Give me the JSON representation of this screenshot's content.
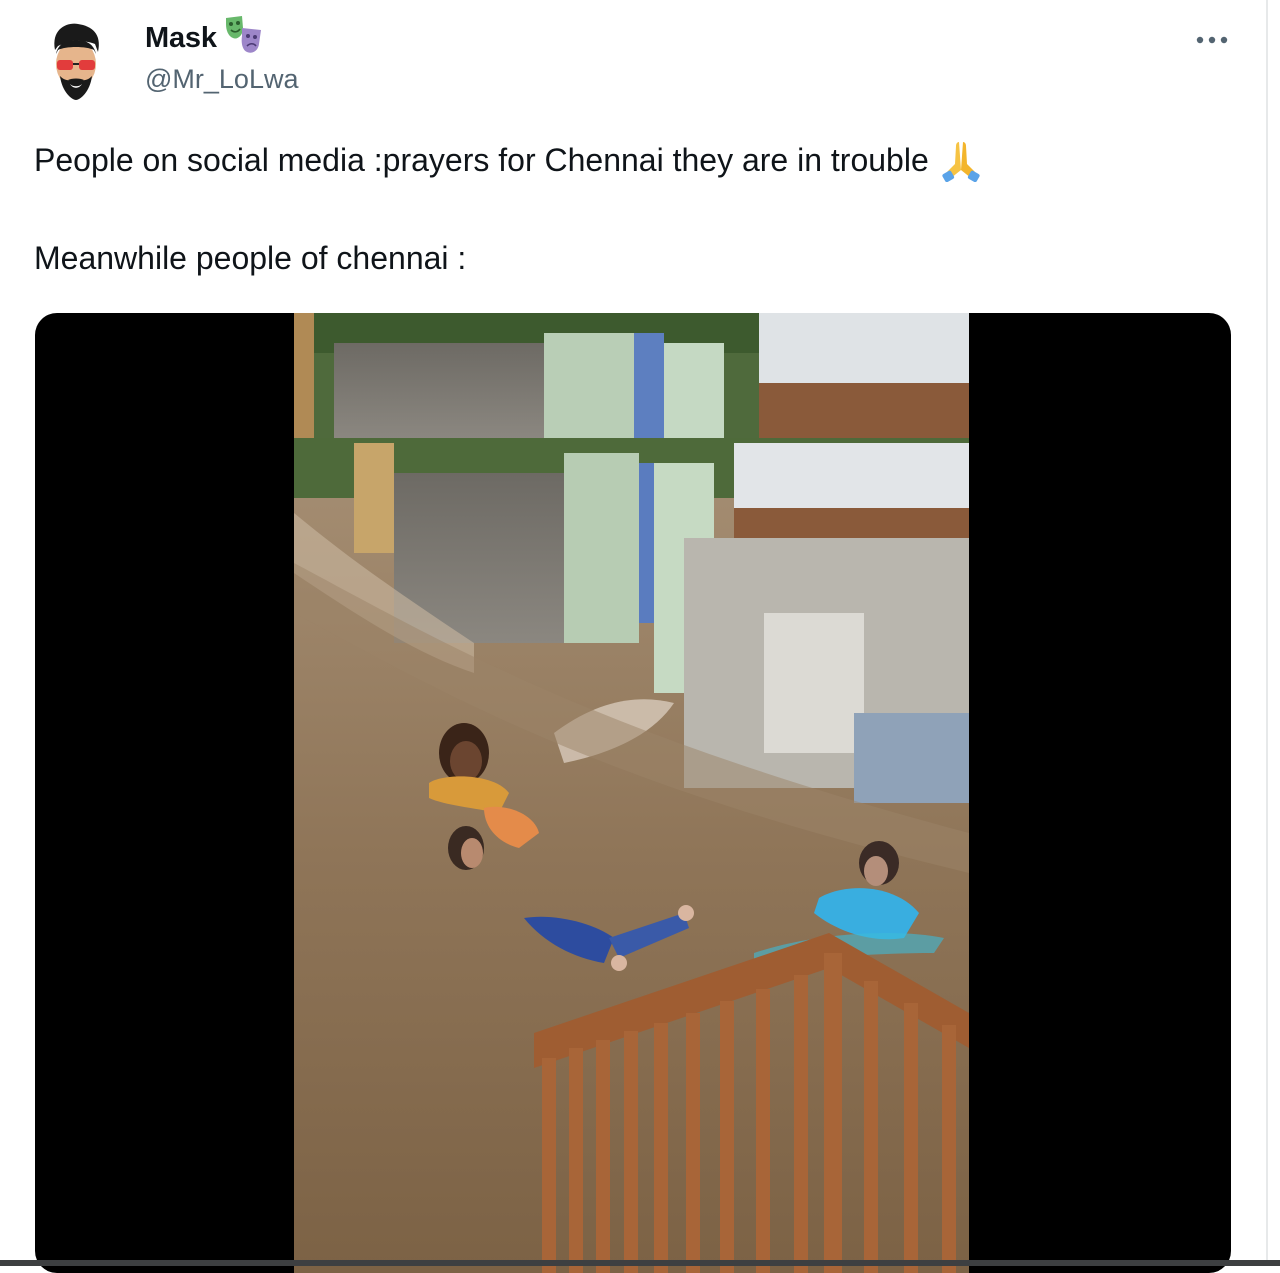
{
  "author": {
    "name": "Mask",
    "handle": "@Mr_LoLwa",
    "badge_icon": "theater-masks-icon",
    "avatar_icon": "cartoon-man-sunglasses-avatar"
  },
  "menu": {
    "icon": "more-dots-icon",
    "label": "..."
  },
  "tweet": {
    "line1": "People on social media :prayers for Chennai they are in trouble",
    "line1_emoji_icon": "folded-hands-icon",
    "line2": "Meanwhile people of chennai :"
  },
  "media": {
    "type": "video",
    "scene_icon": "flooded-street-video-frame"
  },
  "colors": {
    "text": "#0f1419",
    "secondary_text": "#536471",
    "media_background": "#000000",
    "water": "#8a7256",
    "railing": "#9c5a2e"
  }
}
